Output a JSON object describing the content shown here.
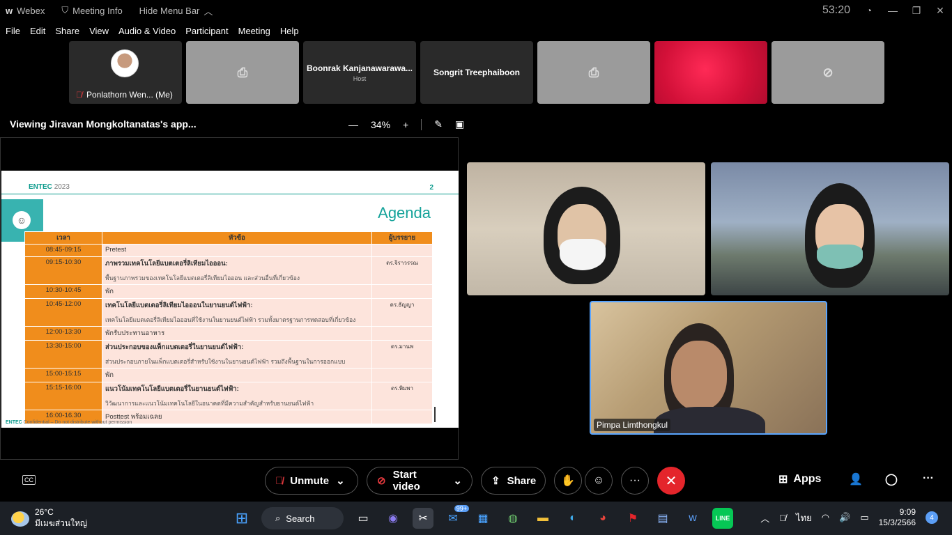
{
  "titlebar": {
    "app_name": "Webex",
    "meeting_info": "Meeting Info",
    "hide_menu": "Hide Menu Bar",
    "timer": "53:20"
  },
  "menu": [
    "File",
    "Edit",
    "Share",
    "View",
    "Audio & Video",
    "Participant",
    "Meeting",
    "Help"
  ],
  "participants": {
    "me": "Ponlathorn Wen... (Me)",
    "host_name": "Boonrak Kanjanawarawa...",
    "host_label": "Host",
    "other_name": "Songrit Treephaiboon"
  },
  "share": {
    "viewing": "Viewing Jiravan Mongkoltanatas's app...",
    "zoom": "34%"
  },
  "slide": {
    "brand": "ENTEC",
    "year": "2023",
    "page": "2",
    "title": "Agenda",
    "headers": [
      "เวลา",
      "หัวข้อ",
      "ผู้บรรยาย"
    ],
    "rows": [
      {
        "time": "08:45-09:15",
        "topic": "Pretest",
        "desc": "",
        "speaker": ""
      },
      {
        "time": "09:15-10:30",
        "topic": "ภาพรวมเทคโนโลยีแบตเตอรี่ลิเทียมไอออน:",
        "desc": "พื้นฐานภาพรวมของเทคโนโลยีแบตเตอรี่ลิเทียมไอออน และส่วนอื่นที่เกี่ยวข้อง",
        "speaker": "ดร.จิราวรรณ"
      },
      {
        "time": "10:30-10:45",
        "topic": "พัก",
        "desc": "",
        "speaker": ""
      },
      {
        "time": "10:45-12:00",
        "topic": "เทคโนโลยีแบตเตอรี่ลิเทียมไอออนในยานยนต์ไฟฟ้า:",
        "desc": "เทคโนโลยีแบตเตอรี่ลิเทียมไอออนที่ใช้งานในยานยนต์ไฟฟ้า รวมทั้งมาตรฐานการทดสอบที่เกี่ยวข้อง",
        "speaker": "ดร.ธัญญา"
      },
      {
        "time": "12:00-13:30",
        "topic": "พักรับประทานอาหาร",
        "desc": "",
        "speaker": ""
      },
      {
        "time": "13:30-15:00",
        "topic": "ส่วนประกอบของแพ็กแบตเตอรี่ในยานยนต์ไฟฟ้า:",
        "desc": "ส่วนประกอบภายในแพ็กแบตเตอรี่สำหรับใช้งานในยานยนต์ไฟฟ้า รวมถึงพื้นฐานในการออกแบบ",
        "speaker": "ดร.มานพ"
      },
      {
        "time": "15:00-15:15",
        "topic": "พัก",
        "desc": "",
        "speaker": ""
      },
      {
        "time": "15:15-16:00",
        "topic": "แนวโน้มเทคโนโลยีแบตเตอรี่ในยานยนต์ไฟฟ้า:",
        "desc": "วิวัฒนาการและแนวโน้มเทคโนโลยีในอนาคตที่มีความสำคัญสำหรับยานยนต์ไฟฟ้า",
        "speaker": "ดร.พิมพา"
      },
      {
        "time": "16:00-16.30",
        "topic": "Posttest พร้อมเฉลย",
        "desc": "",
        "speaker": ""
      }
    ],
    "footer_brand": "ENTEC",
    "footer_text": "Confidential – Do not distribute without permission"
  },
  "videos": {
    "active_speaker": "Pimpa Limthongkul"
  },
  "controls": {
    "unmute": "Unmute",
    "start_video": "Start video",
    "share": "Share",
    "apps": "Apps",
    "cc": "CC"
  },
  "taskbar": {
    "temp": "26°C",
    "weather_desc": "มีเมฆส่วนใหญ่",
    "search": "Search",
    "mail_badge": "99+",
    "lang": "ไทย",
    "time": "9:09",
    "date": "15/3/2566",
    "notifications": "4"
  }
}
